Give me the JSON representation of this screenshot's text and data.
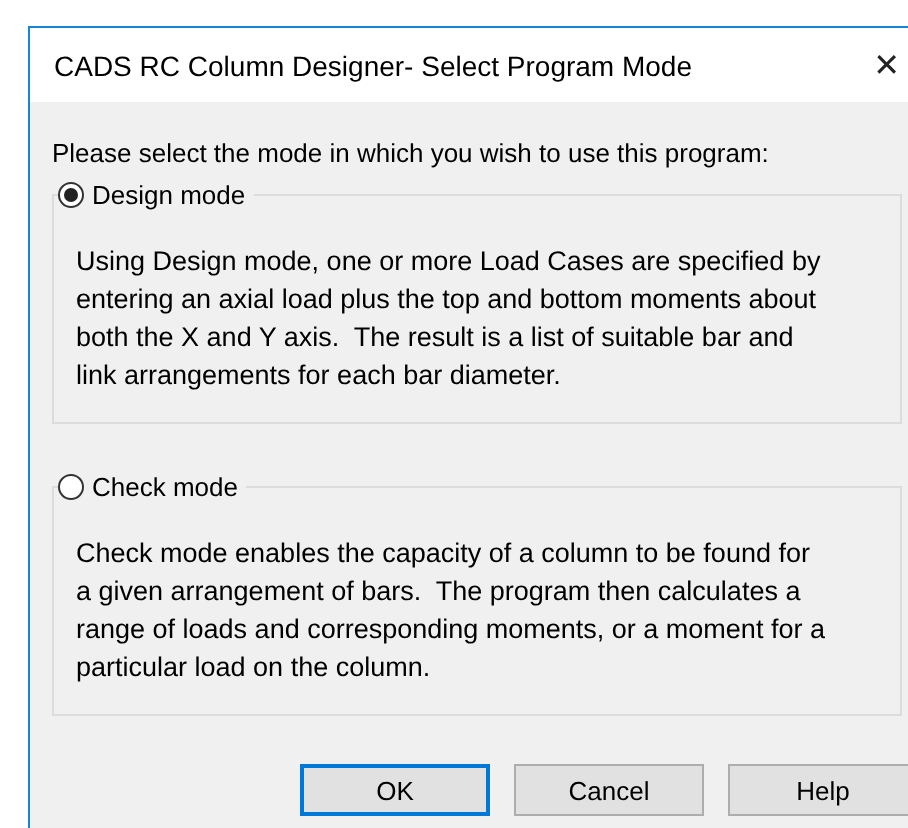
{
  "window": {
    "title": "CADS RC Column Designer- Select Program Mode",
    "close": "✕"
  },
  "prompt": "Please select the mode in which you wish to use this program:",
  "modes": [
    {
      "label": "Design mode",
      "selected": true,
      "description": "Using Design mode, one or more Load Cases are specified by entering an axial load plus the top and bottom moments about both the X and Y axis.  The result is a list of suitable bar and link arrangements for each bar diameter."
    },
    {
      "label": "Check mode",
      "selected": false,
      "description": "Check mode enables the capacity of a column to be found for a given arrangement of bars.  The program then calculates a range of loads and corresponding moments, or a moment for a particular load on the column."
    }
  ],
  "buttons": [
    {
      "label": "OK",
      "default": true
    },
    {
      "label": "Cancel",
      "default": false
    },
    {
      "label": "Help",
      "default": false
    }
  ]
}
